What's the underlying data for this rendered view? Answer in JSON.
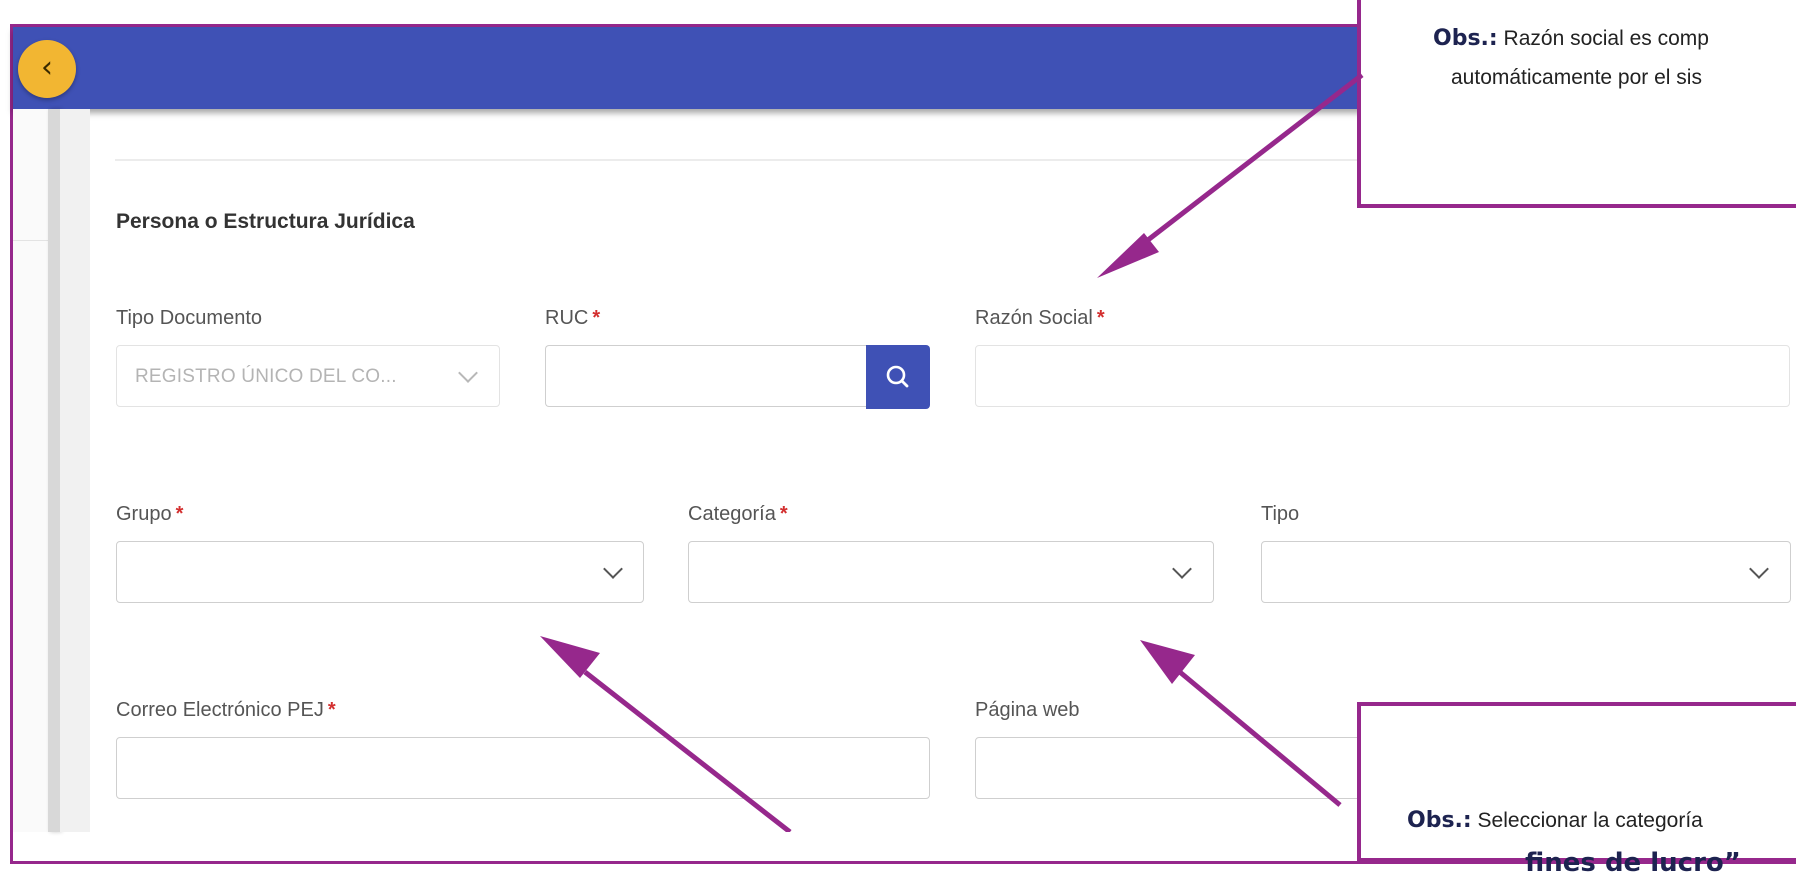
{
  "form": {
    "section_title": "Persona o Estructura Jurídica",
    "tipo_documento": {
      "label": "Tipo Documento",
      "value": "REGISTRO ÚNICO DEL CO..."
    },
    "ruc": {
      "label": "RUC",
      "required_mark": "*",
      "value": ""
    },
    "razon_social": {
      "label": "Razón Social",
      "required_mark": "*",
      "value": ""
    },
    "grupo": {
      "label": "Grupo",
      "required_mark": "*",
      "value": ""
    },
    "categoria": {
      "label": "Categoría",
      "required_mark": "*",
      "value": ""
    },
    "tipo": {
      "label": "Tipo",
      "value": ""
    },
    "correo": {
      "label": "Correo Electrónico PEJ",
      "required_mark": "*",
      "value": ""
    },
    "pagina_web": {
      "label": "Página web",
      "value": ""
    }
  },
  "annotations": {
    "top": {
      "obs_label": "Obs.:",
      "line1": "Razón social es comp",
      "line2": "automáticamente por el sis"
    },
    "bottom": {
      "obs_label": "Obs.:",
      "line1": "Seleccionar la categoría",
      "line2": "fines de lucro”"
    },
    "arrow_color": "#96288c"
  },
  "icons": {
    "back": "chevron-left-icon",
    "search": "search-icon",
    "dropdown": "chevron-down-icon"
  },
  "colors": {
    "header": "#3f51b5",
    "accent": "#f2b632",
    "annotation": "#96288c",
    "required": "#d32f2f"
  }
}
